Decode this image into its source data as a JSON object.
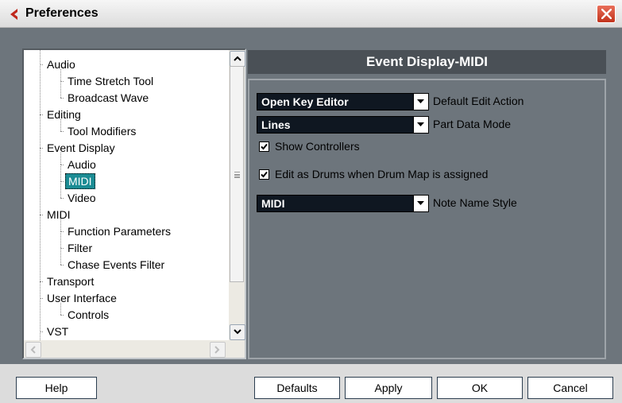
{
  "window": {
    "title": "Preferences",
    "close_icon": "close-icon",
    "logo_icon": "cubase-logo-icon",
    "logo_color": "#c0281c"
  },
  "tree": {
    "items": [
      {
        "label": "Audio",
        "level": 0
      },
      {
        "label": "Time Stretch Tool",
        "level": 1
      },
      {
        "label": "Broadcast Wave",
        "level": 1
      },
      {
        "label": "Editing",
        "level": 0
      },
      {
        "label": "Tool Modifiers",
        "level": 1
      },
      {
        "label": "Event Display",
        "level": 0
      },
      {
        "label": "Audio",
        "level": 1
      },
      {
        "label": "MIDI",
        "level": 1,
        "selected": true
      },
      {
        "label": "Video",
        "level": 1
      },
      {
        "label": "MIDI",
        "level": 0
      },
      {
        "label": "Function Parameters",
        "level": 1
      },
      {
        "label": "Filter",
        "level": 1
      },
      {
        "label": "Chase Events Filter",
        "level": 1
      },
      {
        "label": "Transport",
        "level": 0
      },
      {
        "label": "User Interface",
        "level": 0
      },
      {
        "label": "Controls",
        "level": 1
      },
      {
        "label": "VST",
        "level": 0
      }
    ],
    "selected_color": "#1b8c94"
  },
  "panel": {
    "title": "Event Display-MIDI",
    "default_edit_action": {
      "value": "Open Key Editor",
      "label": "Default Edit Action"
    },
    "part_data_mode": {
      "value": "Lines",
      "label": "Part Data Mode"
    },
    "show_controllers": {
      "label": "Show Controllers",
      "checked": true
    },
    "edit_as_drums": {
      "label": "Edit as Drums when Drum Map is assigned",
      "checked": true
    },
    "note_name_style": {
      "value": "MIDI",
      "label": "Note Name Style"
    }
  },
  "buttons": {
    "help": "Help",
    "defaults": "Defaults",
    "apply": "Apply",
    "ok": "OK",
    "cancel": "Cancel"
  }
}
